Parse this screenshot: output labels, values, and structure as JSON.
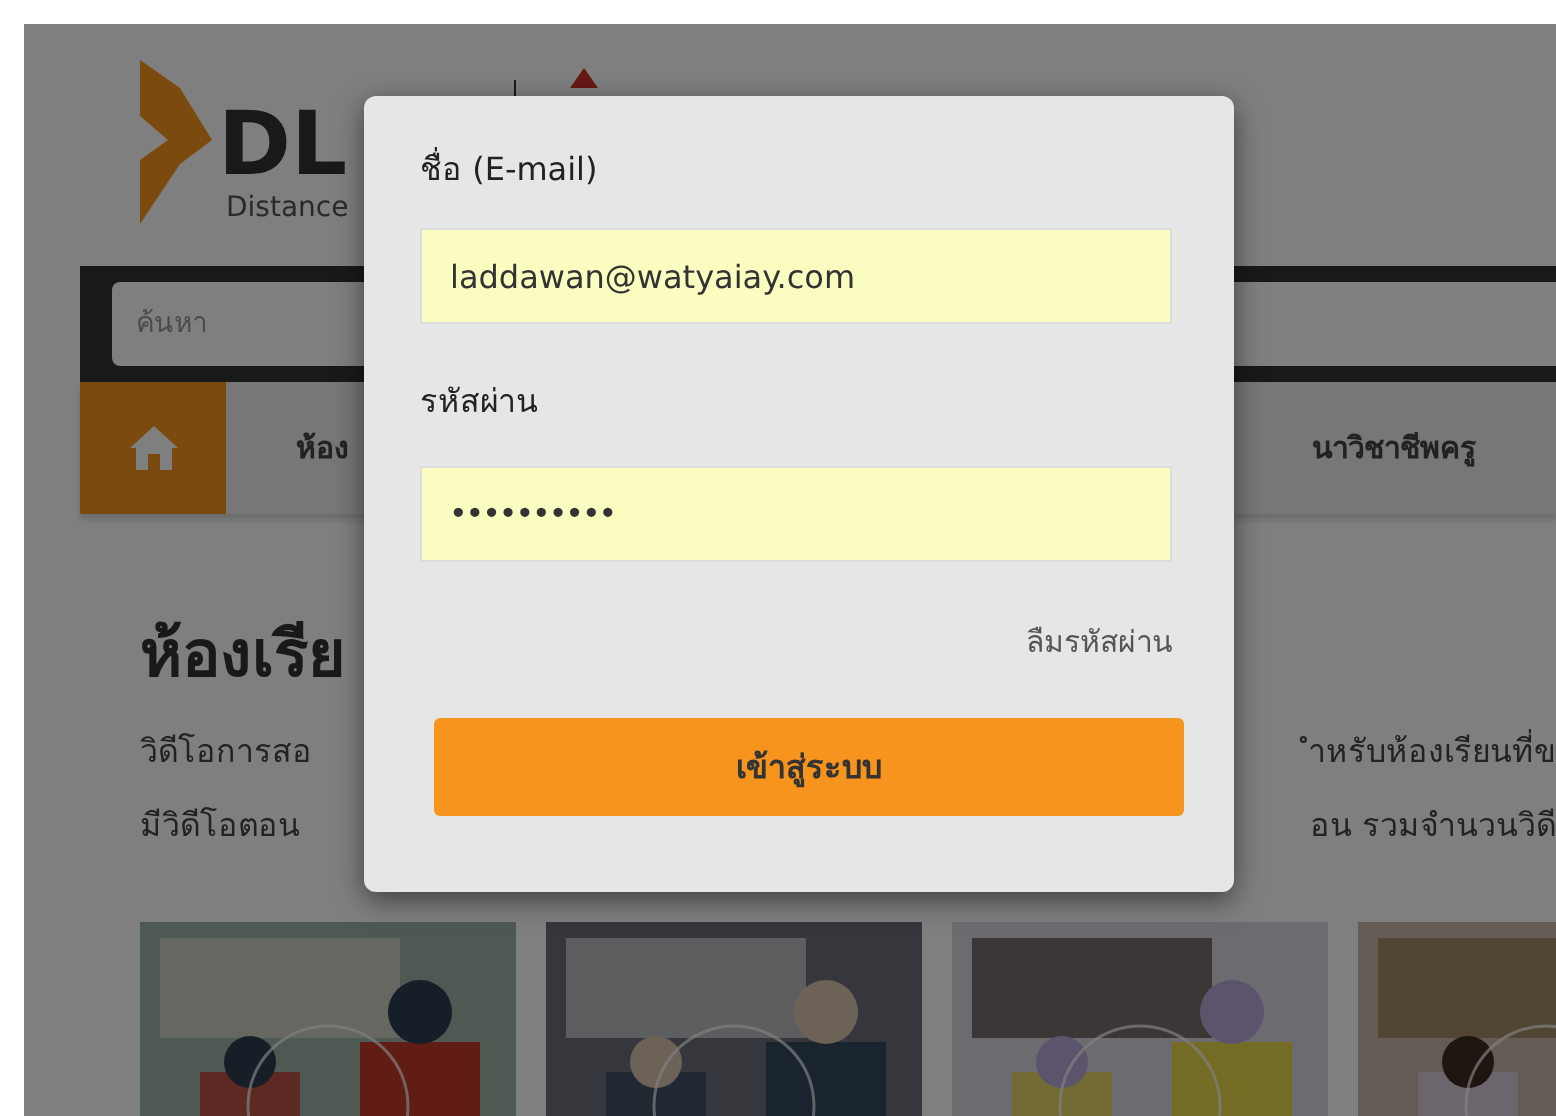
{
  "header": {
    "logo_text": "DL",
    "logo_subtitle": "Distance"
  },
  "search": {
    "placeholder": "ค้นหา"
  },
  "nav": {
    "items": [
      {
        "kind": "home",
        "selected": true
      },
      {
        "kind": "text",
        "label": "ห้อง",
        "selected": false
      },
      {
        "kind": "text",
        "label": "นาวิชาชีพครู",
        "selected": false
      }
    ]
  },
  "section": {
    "title": "ห้องเรีย",
    "lines": [
      {
        "left": "วิดีโอการสอ",
        "right": "ำหรับห้องเรียนที่ข"
      },
      {
        "left": "มีวิดีโอตอน",
        "right": "อน รวมจำนวนวิดี"
      }
    ]
  },
  "login": {
    "email_label": "ชื่อ (E-mail)",
    "email_value": "laddawan@watyaiay.com",
    "password_label": "รหัสผ่าน",
    "password_value": "••••••••••",
    "forgot_link": "ลืมรหัสผ่าน",
    "submit_button": "เข้าสู่ระบบ"
  }
}
